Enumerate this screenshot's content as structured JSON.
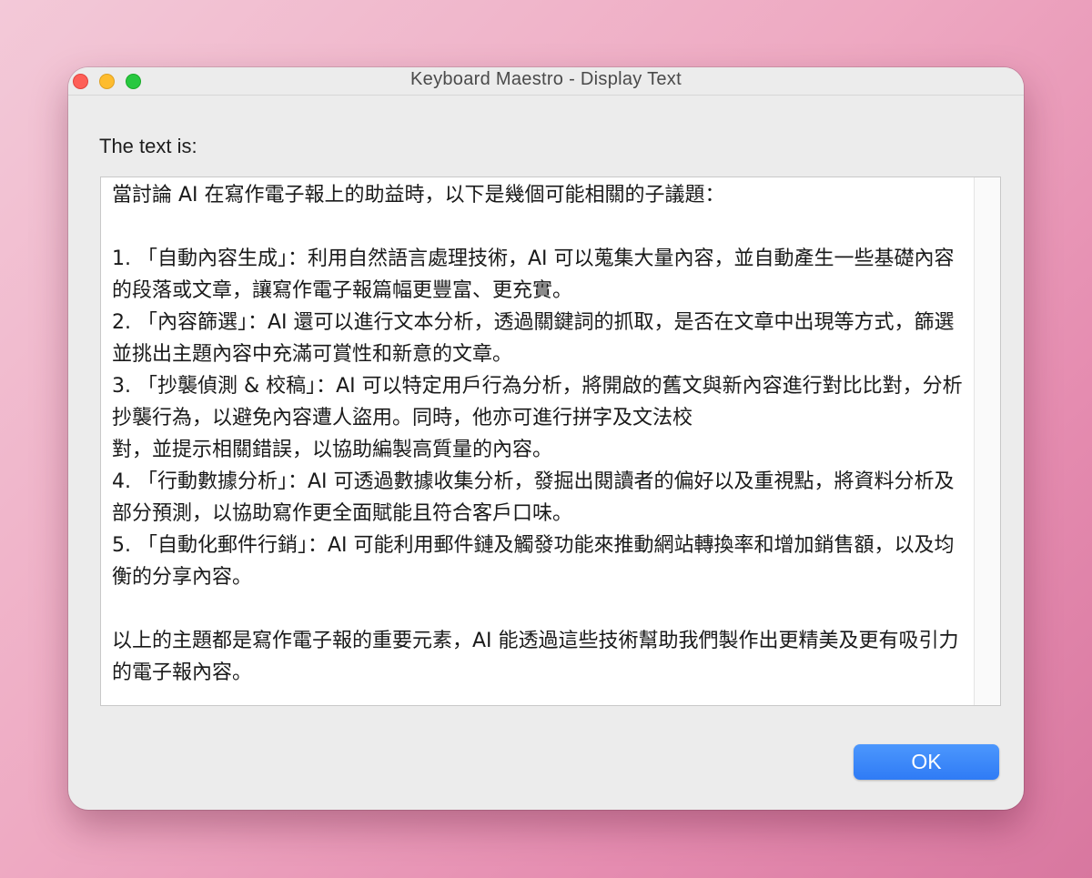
{
  "window": {
    "title": "Keyboard Maestro - Display Text"
  },
  "dialog": {
    "prompt": "The text is:",
    "text_lines": [
      "當討論 AI 在寫作電子報上的助益時，以下是幾個可能相關的子議題：",
      "",
      "1. 「自動內容生成」：利用自然語言處理技術，AI 可以蒐集大量內容，並自動產生一些基礎內容的段落或文章，讓寫作電子報篇幅更豐富、更充實。",
      "2. 「內容篩選」：AI 還可以進行文本分析，透過關鍵詞的抓取，是否在文章中出現等方式，篩選並挑出主題內容中充滿可賞性和新意的文章。",
      "3. 「抄襲偵測 & 校稿」：AI 可以特定用戶行為分析，將開啟的舊文與新內容進行對比比對，分析抄襲行為，以避免內容遭人盜用。同時，他亦可進行拼字及文法校",
      "對，並提示相關錯誤，以協助編製高質量的內容。",
      "4. 「行動數據分析」：AI 可透過數據收集分析，發掘出閱讀者的偏好以及重視點，將資料分析及部分預測，以協助寫作更全面賦能且符合客戶口味。",
      "5. 「自動化郵件行銷」：AI 可能利用郵件鏈及觸發功能來推動網站轉換率和增加銷售額，以及均衡的分享內容。",
      "",
      "以上的主題都是寫作電子報的重要元素，AI 能透過這些技術幫助我們製作出更精美及更有吸引力的電子報內容。"
    ],
    "ok_label": "OK"
  },
  "colors": {
    "accent": "#2f7bf5",
    "close": "#fe5f57",
    "minimize": "#febc2e",
    "maximize": "#28c840"
  }
}
